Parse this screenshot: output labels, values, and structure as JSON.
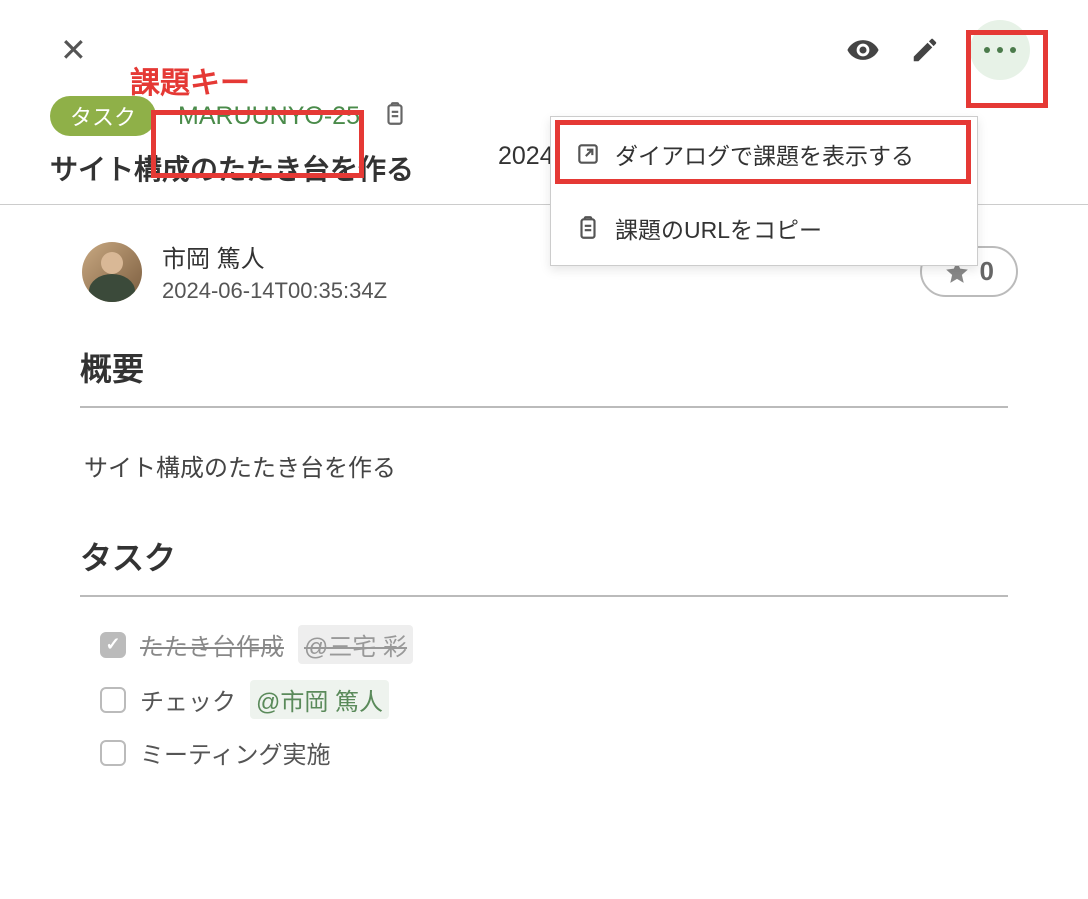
{
  "annotations": {
    "key_label": "課題キー"
  },
  "header": {
    "partial_date_visible": "2024"
  },
  "issue": {
    "type_label": "タスク",
    "key": "MARUUNYO-25",
    "title": "サイト構成のたたき台を作る"
  },
  "dropdown": {
    "items": [
      {
        "icon": "open-external-icon",
        "label": "ダイアログで課題を表示する"
      },
      {
        "icon": "clipboard-icon",
        "label": "課題のURLをコピー"
      }
    ]
  },
  "author": {
    "name": "市岡 篤人",
    "timestamp": "2024-06-14T00:35:34Z"
  },
  "star": {
    "count": "0"
  },
  "sections": {
    "overview": {
      "heading": "概要",
      "body": "サイト構成のたたき台を作る"
    },
    "tasks": {
      "heading": "タスク",
      "items": [
        {
          "done": true,
          "text": "たたき台作成",
          "mention": "@三宅 彩"
        },
        {
          "done": false,
          "text": "チェック",
          "mention": "@市岡 篤人"
        },
        {
          "done": false,
          "text": "ミーティング実施",
          "mention": ""
        }
      ]
    }
  }
}
